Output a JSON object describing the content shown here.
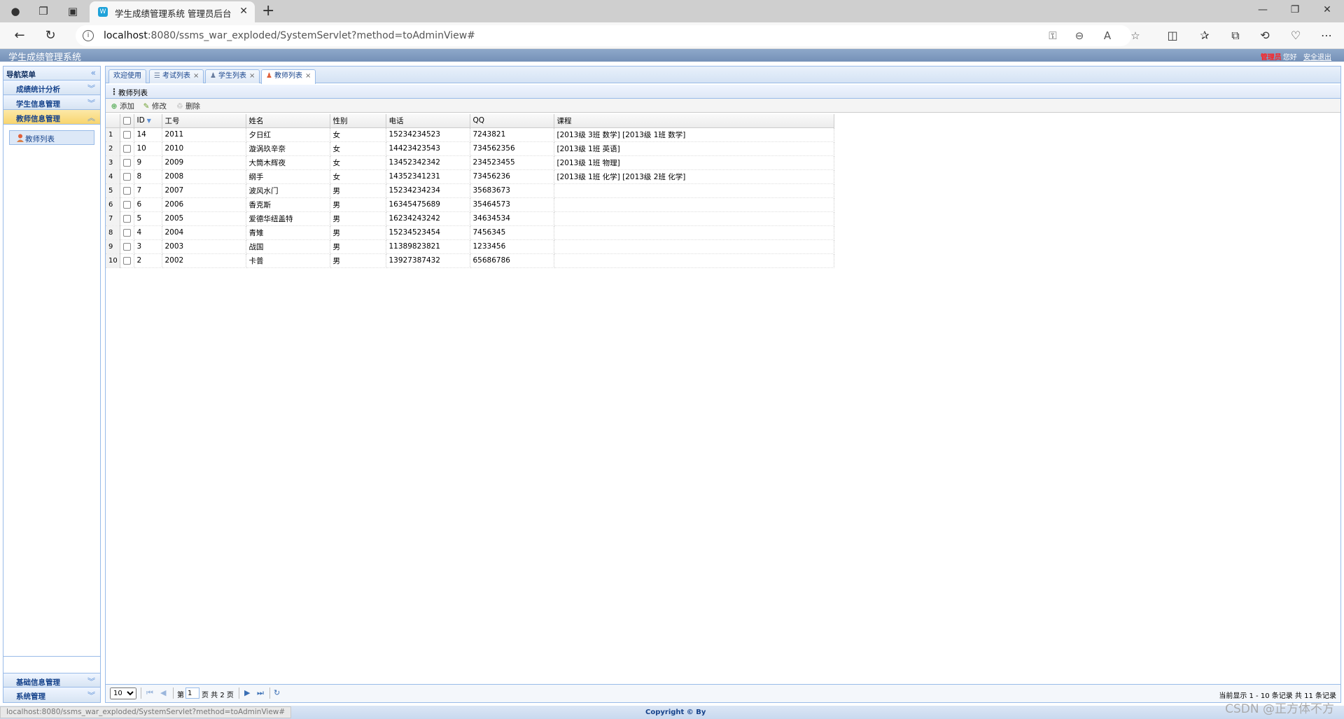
{
  "browser": {
    "tab_title": "学生成绩管理系统 管理员后台",
    "tab_close": "✕",
    "new_tab": "+",
    "url_host": "localhost",
    "url_rest": ":8080/ssms_war_exploded/SystemServlet?method=toAdminView#"
  },
  "app": {
    "title": "学生成绩管理系统",
    "admin_label": "管理员",
    "greeting": "您好",
    "logout": "安全退出"
  },
  "nav": {
    "title": "导航菜单",
    "sections": [
      {
        "label": "成绩统计分析"
      },
      {
        "label": "学生信息管理"
      },
      {
        "label": "教师信息管理"
      }
    ],
    "active_item": "教师列表",
    "bottom_sections": [
      {
        "label": "基础信息管理"
      },
      {
        "label": "系统管理"
      }
    ]
  },
  "tabs": [
    {
      "label": "欢迎使用"
    },
    {
      "label": "考试列表"
    },
    {
      "label": "学生列表"
    },
    {
      "label": "教师列表"
    }
  ],
  "panel": {
    "title": "教师列表"
  },
  "toolbar": {
    "add": "添加",
    "edit": "修改",
    "delete": "删除"
  },
  "grid": {
    "columns": [
      "ID",
      "工号",
      "姓名",
      "性别",
      "电话",
      "QQ",
      "课程"
    ],
    "rows": [
      {
        "n": "1",
        "id": "14",
        "no": "2011",
        "name": "夕日红",
        "sex": "女",
        "phone": "15234234523",
        "qq": "7243821",
        "course": "[2013级 3班 数学]   [2013级 1班 数学]"
      },
      {
        "n": "2",
        "id": "10",
        "no": "2010",
        "name": "漩涡玖辛奈",
        "sex": "女",
        "phone": "14423423543",
        "qq": "734562356",
        "course": "[2013级 1班 英语]"
      },
      {
        "n": "3",
        "id": "9",
        "no": "2009",
        "name": "大筒木辉夜",
        "sex": "女",
        "phone": "13452342342",
        "qq": "234523455",
        "course": "[2013级 1班 物理]"
      },
      {
        "n": "4",
        "id": "8",
        "no": "2008",
        "name": "纲手",
        "sex": "女",
        "phone": "14352341231",
        "qq": "73456236",
        "course": "[2013级 1班 化学]   [2013级 2班 化学]"
      },
      {
        "n": "5",
        "id": "7",
        "no": "2007",
        "name": "波风水门",
        "sex": "男",
        "phone": "15234234234",
        "qq": "35683673",
        "course": ""
      },
      {
        "n": "6",
        "id": "6",
        "no": "2006",
        "name": "香克斯",
        "sex": "男",
        "phone": "16345475689",
        "qq": "35464573",
        "course": ""
      },
      {
        "n": "7",
        "id": "5",
        "no": "2005",
        "name": "爱德华纽盖特",
        "sex": "男",
        "phone": "16234243242",
        "qq": "34634534",
        "course": ""
      },
      {
        "n": "8",
        "id": "4",
        "no": "2004",
        "name": "青雉",
        "sex": "男",
        "phone": "15234523454",
        "qq": "7456345",
        "course": ""
      },
      {
        "n": "9",
        "id": "3",
        "no": "2003",
        "name": "战国",
        "sex": "男",
        "phone": "11389823821",
        "qq": "1233456",
        "course": ""
      },
      {
        "n": "10",
        "id": "2",
        "no": "2002",
        "name": "卡普",
        "sex": "男",
        "phone": "13927387432",
        "qq": "65686786",
        "course": ""
      }
    ]
  },
  "pager": {
    "page_size": "10",
    "page_prefix": "第",
    "current_page": "1",
    "page_suffix": "页 共 2 页",
    "info": "当前显示 1 - 10 条记录 共 11 条记录"
  },
  "footer": {
    "copyright": "Copyright © By",
    "status_url": "localhost:8080/ssms_war_exploded/SystemServlet?method=toAdminView#",
    "watermark": "CSDN @正方体不方"
  },
  "colors": {
    "header": "#7591b8",
    "active_section": "#f8d56e",
    "border": "#99bbe8"
  }
}
